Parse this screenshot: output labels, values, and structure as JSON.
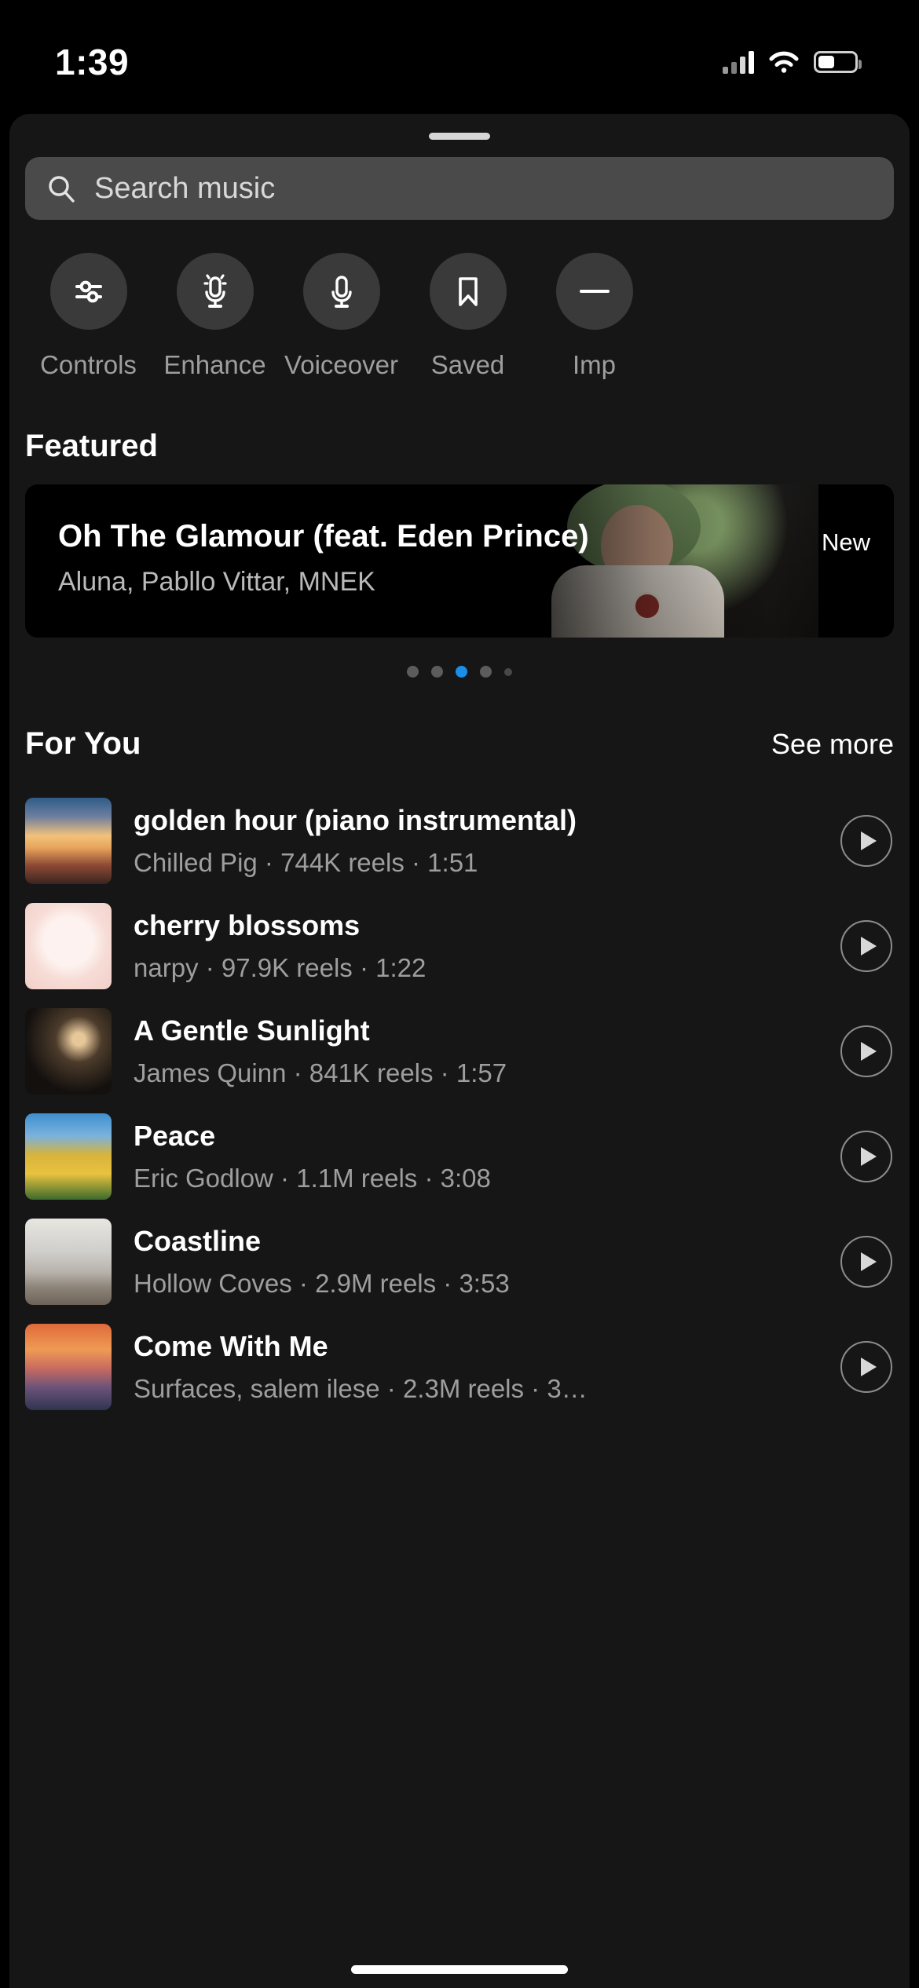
{
  "status_bar": {
    "time": "1:39",
    "signal_icon": "cellular-signal-icon",
    "wifi_icon": "wifi-icon",
    "battery_icon": "battery-icon"
  },
  "sheet": {
    "grabber": "drag-handle"
  },
  "search": {
    "placeholder": "Search music",
    "value": "",
    "icon": "search-icon"
  },
  "quick_actions": [
    {
      "label": "Controls",
      "icon": "sliders-icon"
    },
    {
      "label": "Enhance",
      "icon": "enhance-mic-icon"
    },
    {
      "label": "Voiceover",
      "icon": "microphone-icon"
    },
    {
      "label": "Saved",
      "icon": "bookmark-icon"
    },
    {
      "label": "Imp",
      "icon": "import-icon"
    }
  ],
  "featured": {
    "title": "Featured",
    "card": {
      "track_title": "Oh The Glamour (feat. Eden Prince)",
      "artists": "Aluna, Pabllo Vittar, MNEK",
      "badge": "New"
    },
    "pagination": {
      "count": 5,
      "active_index": 2,
      "active_color": "#1a8fe8",
      "inactive_color": "#5c5c5c"
    }
  },
  "for_you": {
    "title": "For You",
    "see_more_label": "See more",
    "tracks": [
      {
        "title": "golden hour (piano instrumental)",
        "subtitle": "Chilled Pig · 744K reels · 1:51",
        "artist": "Chilled Pig",
        "reels": "744K reels",
        "duration": "1:51",
        "art": "art-golden",
        "play_icon": "play-icon"
      },
      {
        "title": "cherry blossoms",
        "subtitle": "narpy · 97.9K reels · 1:22",
        "artist": "narpy",
        "reels": "97.9K reels",
        "duration": "1:22",
        "art": "art-cherry",
        "play_icon": "play-icon"
      },
      {
        "title": "A Gentle Sunlight",
        "subtitle": "James Quinn · 841K reels · 1:57",
        "artist": "James Quinn",
        "reels": "841K reels",
        "duration": "1:57",
        "art": "art-gentle",
        "play_icon": "play-icon"
      },
      {
        "title": "Peace",
        "subtitle": "Eric Godlow · 1.1M reels · 3:08",
        "artist": "Eric Godlow",
        "reels": "1.1M reels",
        "duration": "3:08",
        "art": "art-peace",
        "play_icon": "play-icon"
      },
      {
        "title": "Coastline",
        "subtitle": "Hollow Coves · 2.9M reels · 3:53",
        "artist": "Hollow Coves",
        "reels": "2.9M reels",
        "duration": "3:53",
        "art": "art-coast",
        "play_icon": "play-icon"
      },
      {
        "title": "Come With Me",
        "subtitle": "Surfaces, salem ilese · 2.3M reels · 3…",
        "artist": "Surfaces, salem ilese",
        "reels": "2.3M reels",
        "duration": "3…",
        "art": "art-come",
        "play_icon": "play-icon"
      }
    ]
  },
  "home_indicator": "home-indicator"
}
